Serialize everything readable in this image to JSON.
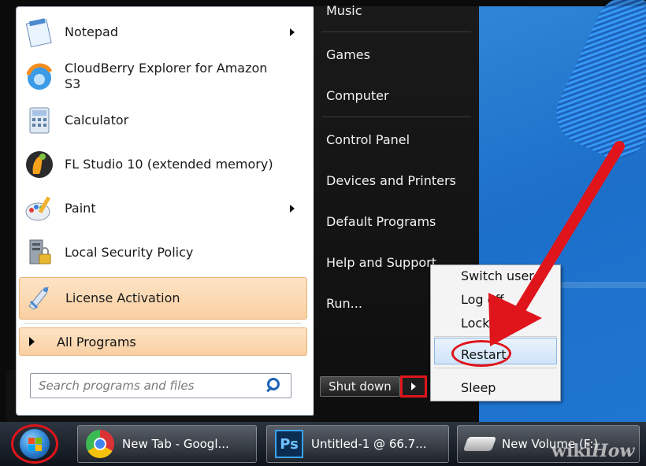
{
  "start_menu": {
    "programs": [
      {
        "label": "Notepad",
        "icon": "notepad-icon",
        "has_submenu": true
      },
      {
        "label": "CloudBerry Explorer for Amazon S3",
        "icon": "cloudberry-icon",
        "has_submenu": false
      },
      {
        "label": "Calculator",
        "icon": "calculator-icon",
        "has_submenu": false
      },
      {
        "label": "FL Studio 10 (extended memory)",
        "icon": "fl-studio-icon",
        "has_submenu": false
      },
      {
        "label": "Paint",
        "icon": "paint-icon",
        "has_submenu": true
      },
      {
        "label": "Local Security Policy",
        "icon": "security-policy-icon",
        "has_submenu": false
      },
      {
        "label": "License Activation",
        "icon": "license-icon",
        "has_submenu": false
      }
    ],
    "all_programs_label": "All Programs",
    "search_placeholder": "Search programs and files",
    "right_items": [
      "Music",
      "Games",
      "Computer",
      "Control Panel",
      "Devices and Printers",
      "Default Programs",
      "Help and Support",
      "Run..."
    ],
    "shutdown_label": "Shut down"
  },
  "shutdown_menu": {
    "items": [
      "Switch user",
      "Log off",
      "Lock",
      "Restart",
      "Sleep"
    ],
    "highlighted": "Restart"
  },
  "taskbar": {
    "buttons": [
      {
        "label": "New Tab - Googl...",
        "icon": "chrome-icon"
      },
      {
        "label": "Untitled-1 @ 66.7...",
        "icon": "photoshop-icon",
        "icon_text": "Ps"
      },
      {
        "label": "New Volume (F:)",
        "icon": "drive-icon"
      }
    ]
  },
  "watermark": {
    "wiki": "wiki",
    "how": "How"
  },
  "colors": {
    "annotation_red": "#e0141b",
    "menu_highlight": "#f9cfa1",
    "desktop_blue": "#1e76d1"
  }
}
